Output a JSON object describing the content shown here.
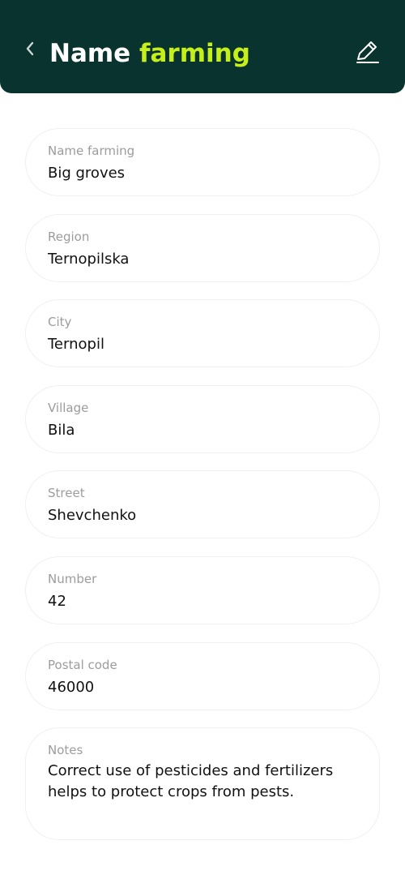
{
  "header": {
    "title_part1": "Name",
    "title_part2": "farming",
    "back_icon": "chevron-left-icon",
    "edit_icon": "pencil-edit-icon",
    "colors": {
      "background": "#08332e",
      "title": "#ffffff",
      "accent": "#c6ee1b"
    }
  },
  "fields": [
    {
      "label": "Name farming",
      "value": "Big groves"
    },
    {
      "label": "Region",
      "value": "Ternopilska"
    },
    {
      "label": "City",
      "value": "Ternopil"
    },
    {
      "label": "Village",
      "value": "Bila"
    },
    {
      "label": "Street",
      "value": "Shevchenko"
    },
    {
      "label": "Number",
      "value": "42"
    },
    {
      "label": "Postal code",
      "value": "46000"
    },
    {
      "label": "Notes",
      "value": "Correct use of pesticides and fertilizers helps to protect crops from pests."
    }
  ]
}
